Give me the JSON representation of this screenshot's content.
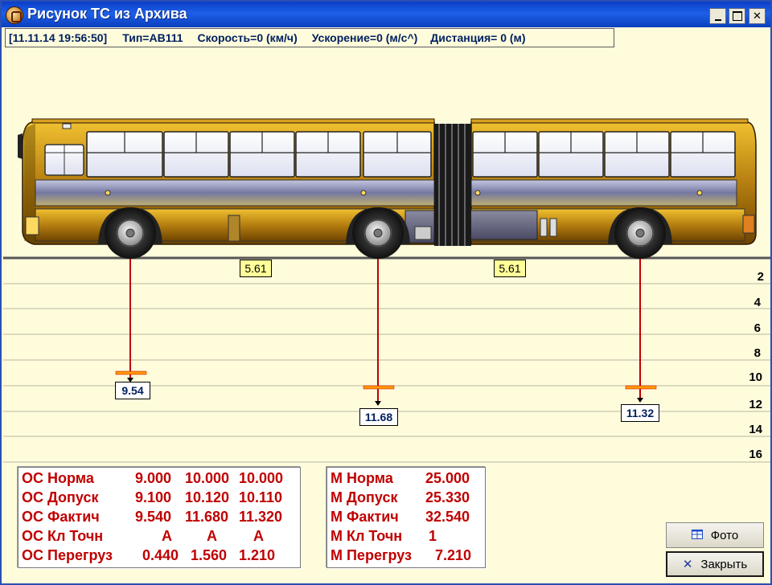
{
  "window": {
    "title": "Рисунок ТС из Архива"
  },
  "info": {
    "datetime": "[11.11.14 19:56:50]",
    "type": "Тип=АВ111",
    "speed": "Скорость=0 (км/ч)",
    "accel": "Ускорение=0 (м/с^)",
    "distance": "Дистанция= 0 (м)"
  },
  "scale": {
    "ticks": [
      "2",
      "4",
      "6",
      "8",
      "10",
      "12",
      "14",
      "16"
    ]
  },
  "axle_gaps": [
    "5.61",
    "5.61"
  ],
  "axle_loads": [
    "9.54",
    "11.68",
    "11.32"
  ],
  "axle_table": {
    "rows": [
      {
        "label": "ОС Норма",
        "v1": "9.000",
        "v2": "10.000",
        "v3": "10.000"
      },
      {
        "label": "ОС Допуск",
        "v1": "9.100",
        "v2": "10.120",
        "v3": "10.110"
      },
      {
        "label": "ОС Фактич",
        "v1": "9.540",
        "v2": "11.680",
        "v3": "11.320"
      },
      {
        "label": "ОС Кл Точн",
        "v1": "А",
        "v2": "А",
        "v3": "А"
      },
      {
        "label": "ОС Перегруз",
        "v1": "0.440",
        "v2": "1.560",
        "v3": "1.210"
      }
    ]
  },
  "mass_table": {
    "rows": [
      {
        "label": "М Норма",
        "value": "25.000"
      },
      {
        "label": "М Допуск",
        "value": "25.330"
      },
      {
        "label": "М Фактич",
        "value": "32.540"
      },
      {
        "label": "М Кл Точн",
        "value": "1"
      },
      {
        "label": "М Перегруз",
        "value": "7.210"
      }
    ]
  },
  "buttons": {
    "photo": "Фото",
    "close": "Закрыть"
  },
  "colors": {
    "accent_red": "#c00000",
    "background": "#fffcdc",
    "title_blue": "#0a3ec7"
  }
}
